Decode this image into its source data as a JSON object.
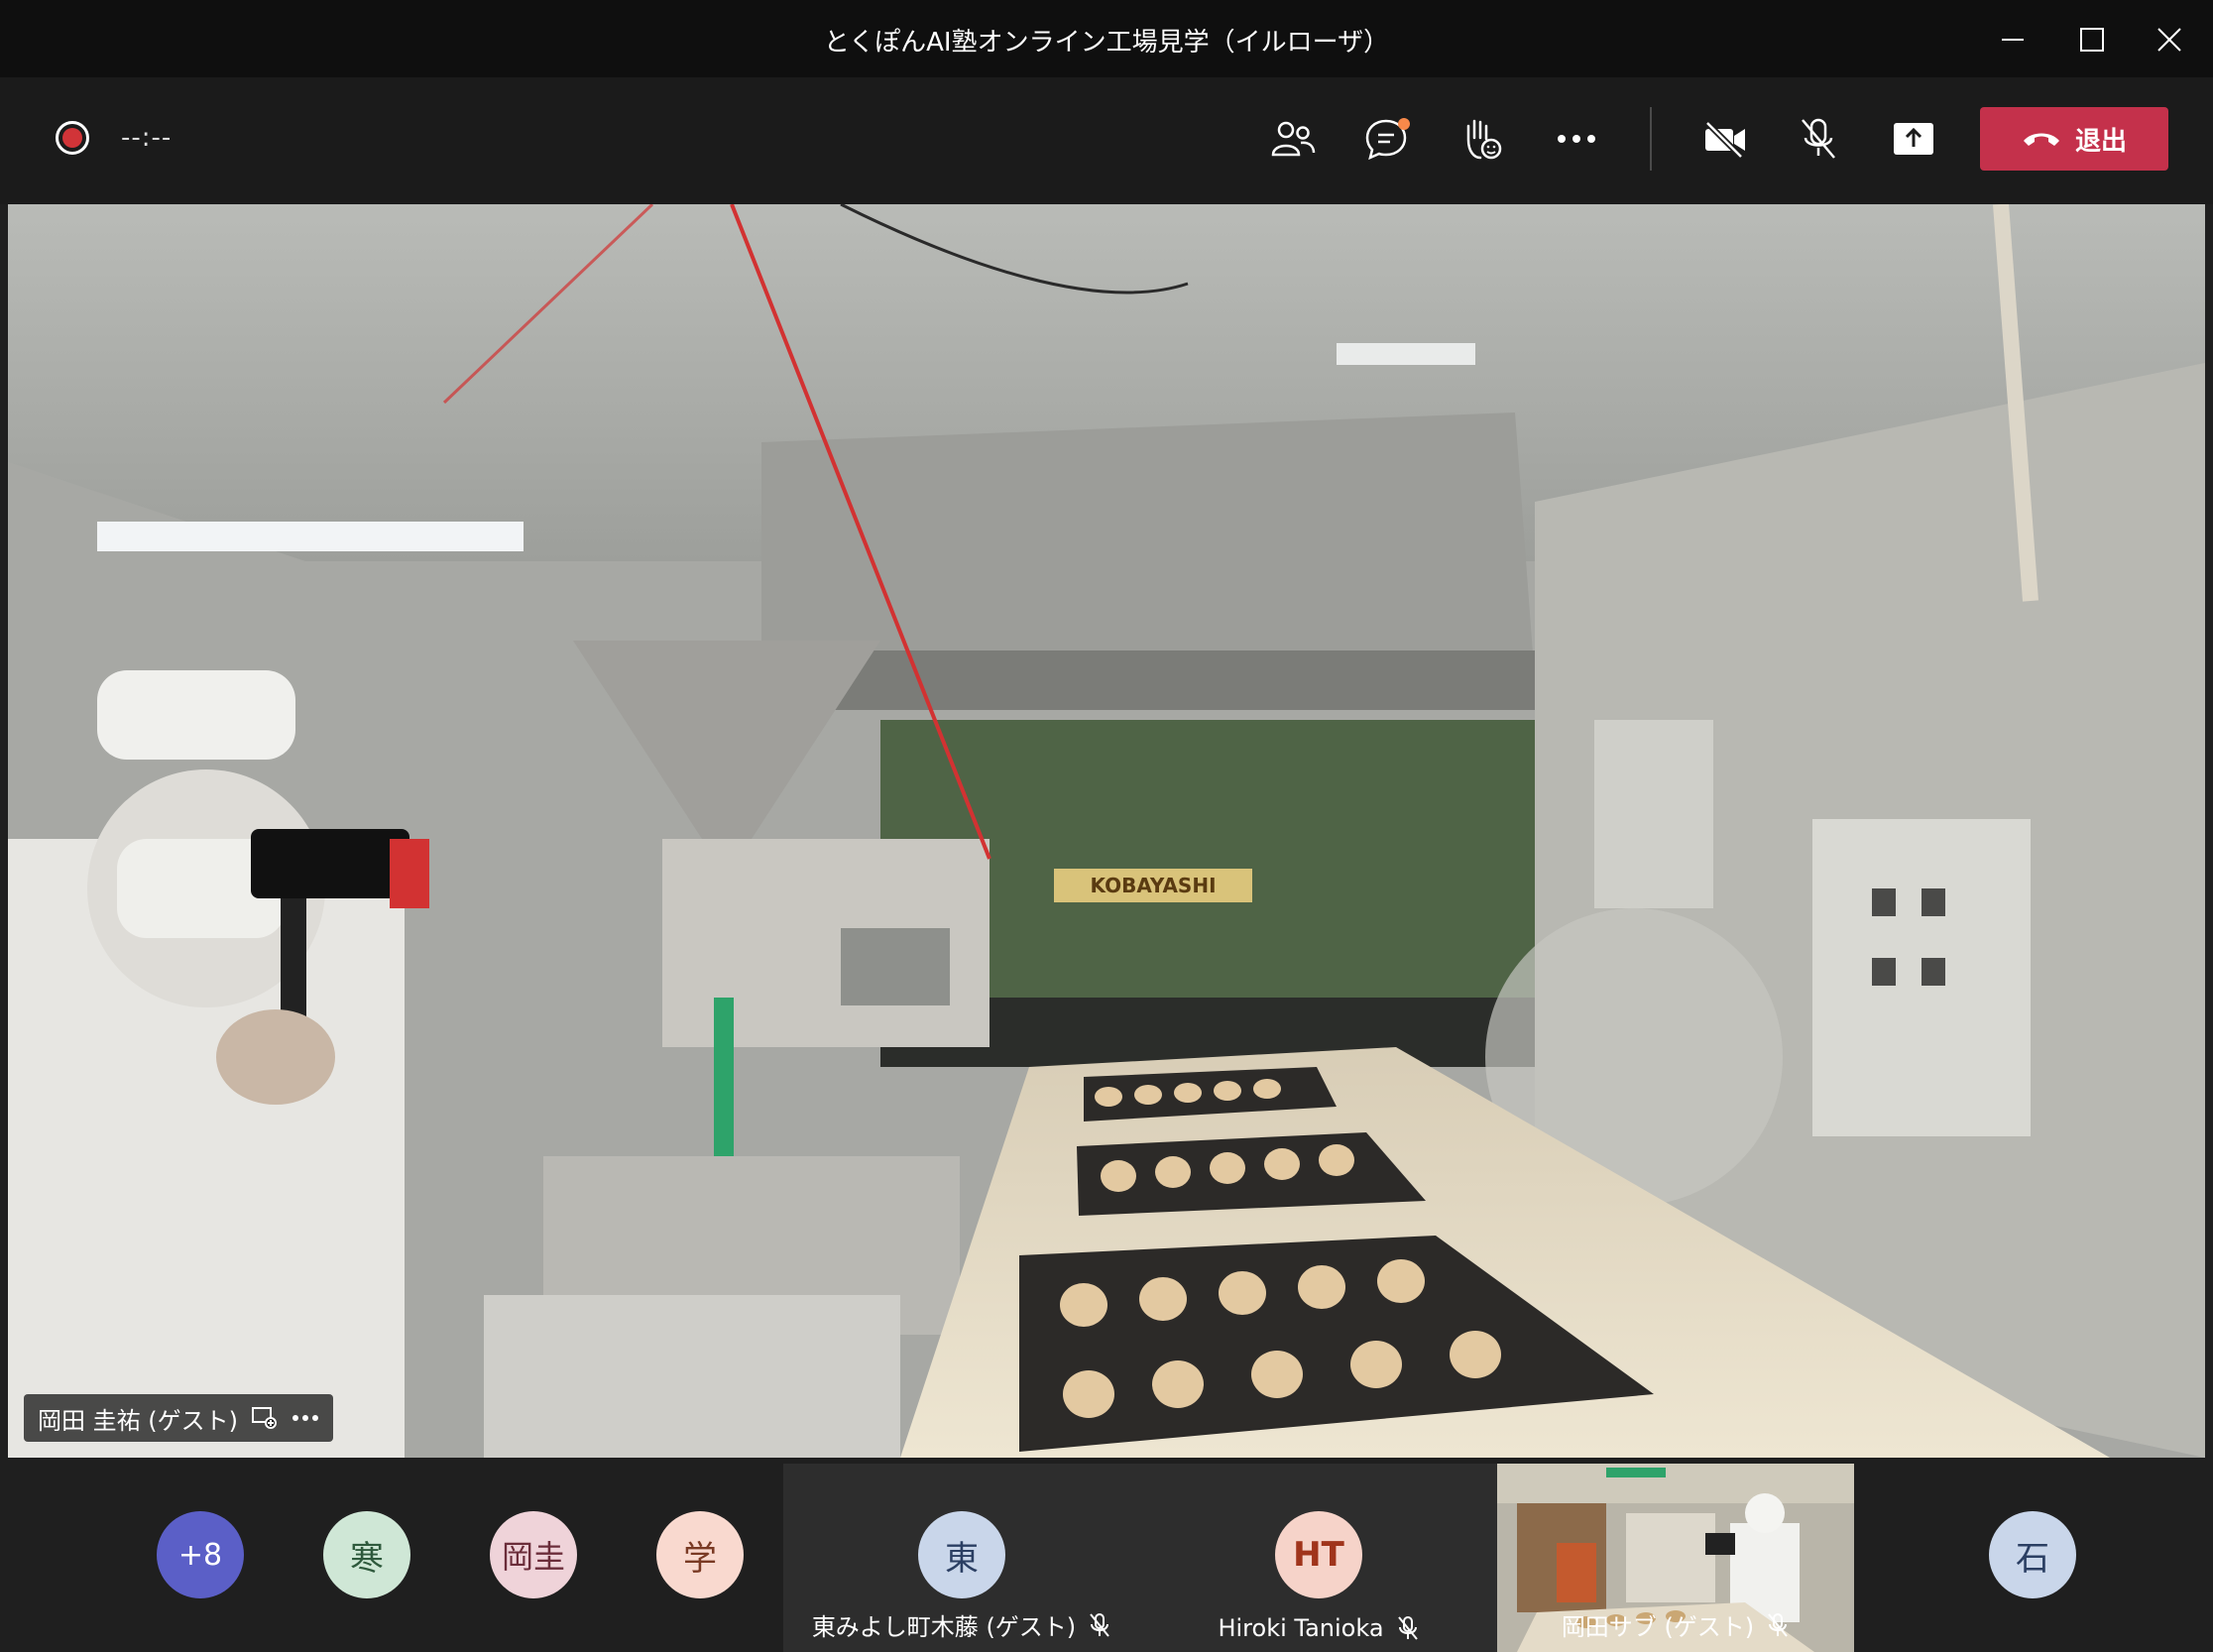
{
  "window": {
    "title": "とくぽんAI塾オンライン工場見学（イルローザ）"
  },
  "toolbar": {
    "timer": "--:--",
    "leave_label": "退出"
  },
  "main_video": {
    "participant_name": "岡田 圭祐 (ゲスト)",
    "banner_text": "KOBAYASHI"
  },
  "participants": {
    "overflow": {
      "label": "+8",
      "color": "#5b5fc7"
    },
    "avatars": [
      {
        "initials": "寒",
        "bg": "#cfe7d6",
        "fg": "#2f5a3d"
      },
      {
        "initials": "岡圭",
        "bg": "#efd3d9",
        "fg": "#6b2d3a"
      },
      {
        "initials": "学",
        "bg": "#f9d9cf",
        "fg": "#7a3a24"
      },
      {
        "initials": "石",
        "bg": "#c9d6ea",
        "fg": "#2b3f63"
      }
    ],
    "tiles": [
      {
        "initials": "東",
        "name": "東みよし町木藤 (ゲスト)",
        "bg": "#c9d6ea",
        "fg": "#2b3f63"
      },
      {
        "initials": "HT",
        "name": "Hiroki Tanioka",
        "bg": "#f6d3c9",
        "fg": "#a0341b"
      },
      {
        "name": "岡田サブ (ゲスト)"
      }
    ]
  },
  "icons": {
    "record": "record-icon",
    "participants": "people-icon",
    "chat": "chat-icon",
    "raise_hand": "raise-hand-icon",
    "more": "more-icon",
    "camera": "camera-off-icon",
    "mic": "mic-off-icon",
    "share": "share-icon",
    "hangup": "hangup-icon"
  }
}
